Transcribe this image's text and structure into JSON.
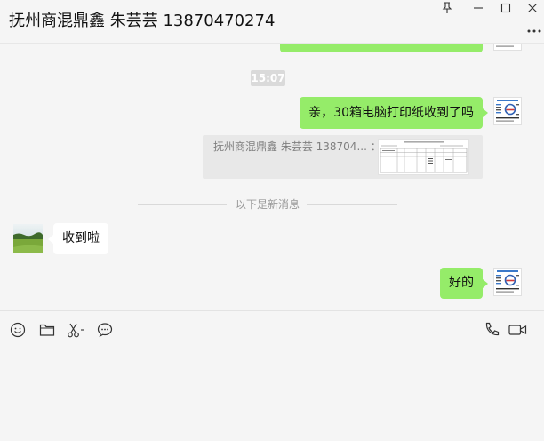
{
  "window": {
    "title": "抚州商混鼎鑫 朱芸芸 13870470274",
    "controls": [
      "pin-icon",
      "minimize-icon",
      "maximize-icon",
      "close-icon"
    ],
    "more_icon": "more-icon"
  },
  "colors": {
    "background": "#f5f5f5",
    "self_bubble": "#95ec69",
    "other_bubble": "#ffffff",
    "timestamp_bg": "#dadada",
    "quote_bg": "#e8e8e8"
  },
  "chat": {
    "timestamp": "15:07",
    "messages": [
      {
        "outgoing": true,
        "text": "亲，30箱电脑打印纸收到了吗",
        "avatar_icon": "business-card-avatar"
      },
      {
        "outgoing": false,
        "text": "收到啦",
        "avatar_icon": "landscape-avatar"
      },
      {
        "outgoing": true,
        "text": "好的",
        "avatar_icon": "business-card-avatar"
      }
    ],
    "quote": {
      "text": "抚州商混鼎鑫 朱芸芸 138704... ：",
      "thumbnail_icon": "document-thumbnail-icon"
    },
    "divider_label": "以下是新消息"
  },
  "toolbar": {
    "left_icons": [
      "emoji-icon",
      "folder-icon",
      "scissors-icon",
      "chat-history-icon"
    ],
    "right_icons": [
      "phone-icon",
      "video-call-icon"
    ]
  }
}
